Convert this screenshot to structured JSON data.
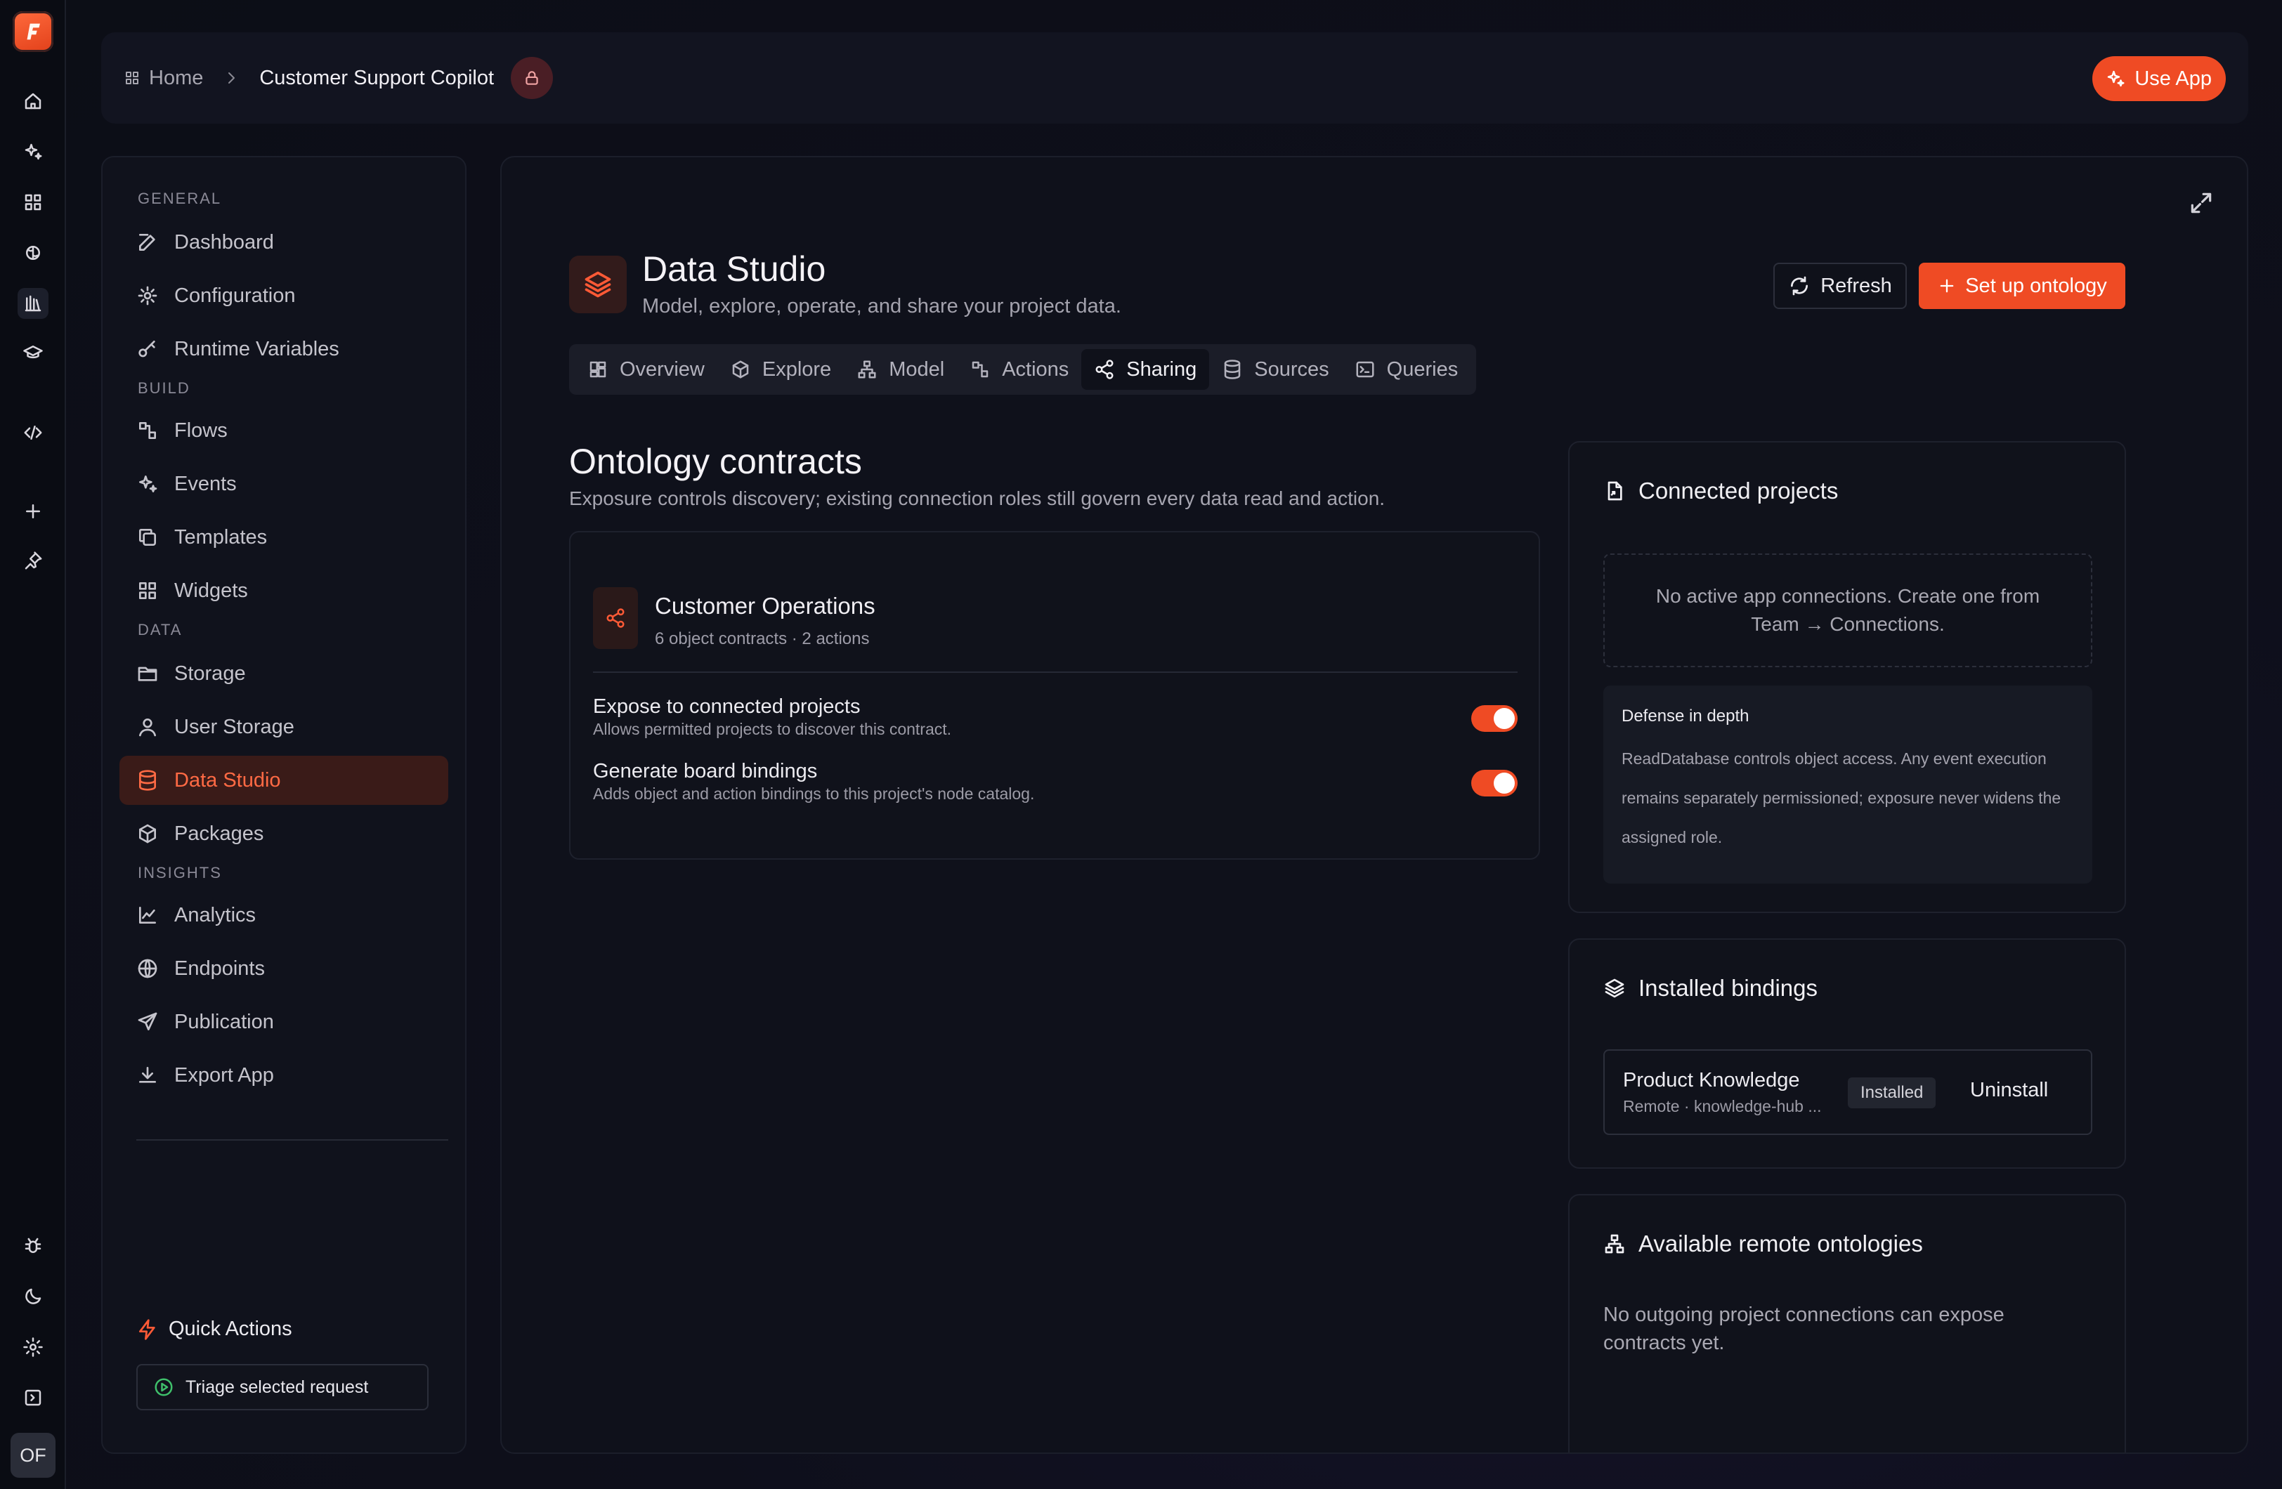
{
  "header": {
    "crumb_home": "Home",
    "crumb_current": "Customer Support Copilot",
    "use_app": "Use App"
  },
  "sidebar": {
    "sections": [
      "GENERAL",
      "BUILD",
      "DATA",
      "INSIGHTS"
    ],
    "items": [
      {
        "label": "Dashboard",
        "icon": "edit-icon"
      },
      {
        "label": "Configuration",
        "icon": "gear-icon"
      },
      {
        "label": "Runtime Variables",
        "icon": "key-icon"
      },
      {
        "label": "Flows",
        "icon": "flows-icon"
      },
      {
        "label": "Events",
        "icon": "sparkles-icon"
      },
      {
        "label": "Templates",
        "icon": "copy-icon"
      },
      {
        "label": "Widgets",
        "icon": "grid-icon"
      },
      {
        "label": "Storage",
        "icon": "folder-icon"
      },
      {
        "label": "User Storage",
        "icon": "user-icon"
      },
      {
        "label": "Data Studio",
        "icon": "database-icon"
      },
      {
        "label": "Packages",
        "icon": "package-icon"
      },
      {
        "label": "Analytics",
        "icon": "chart-icon"
      },
      {
        "label": "Endpoints",
        "icon": "globe-icon"
      },
      {
        "label": "Publication",
        "icon": "send-icon"
      },
      {
        "label": "Export App",
        "icon": "download-icon"
      }
    ],
    "quick_actions_title": "Quick Actions",
    "quick_action_button": "Triage selected request"
  },
  "rail": {
    "avatar": "OF"
  },
  "main": {
    "title": "Data Studio",
    "subtitle": "Model, explore, operate, and share your project data.",
    "refresh_label": "Refresh",
    "setup_label": "Set up ontology",
    "tabs": [
      {
        "label": "Overview"
      },
      {
        "label": "Explore"
      },
      {
        "label": "Model"
      },
      {
        "label": "Actions"
      },
      {
        "label": "Sharing"
      },
      {
        "label": "Sources"
      },
      {
        "label": "Queries"
      }
    ],
    "active_tab": "Sharing",
    "section_title": "Ontology contracts",
    "section_subtitle": "Exposure controls discovery; existing connection roles still govern every data read and action.",
    "contract": {
      "name": "Customer Operations",
      "meta": "6 object contracts · 2 actions",
      "options": [
        {
          "label": "Expose to connected projects",
          "desc": "Allows permitted projects to discover this contract.",
          "enabled": true
        },
        {
          "label": "Generate board bindings",
          "desc": "Adds object and action bindings to this project's node catalog.",
          "enabled": true
        }
      ]
    },
    "connected": {
      "title": "Connected projects",
      "empty": "No active app connections. Create one from Team → Connections.",
      "defense_title": "Defense in depth",
      "defense_body": "ReadDatabase controls object access. Any event execution remains separately permissioned; exposure never widens the assigned role."
    },
    "installed": {
      "title": "Installed bindings",
      "name": "Product Knowledge",
      "meta": "Remote · knowledge-hub ...",
      "badge": "Installed",
      "action": "Uninstall"
    },
    "remote": {
      "title": "Available remote ontologies",
      "empty": "No outgoing project connections can expose contracts yet."
    }
  },
  "colors": {
    "accent": "#ef4b24",
    "background": "#0d0f18",
    "panel": "#10121b"
  }
}
